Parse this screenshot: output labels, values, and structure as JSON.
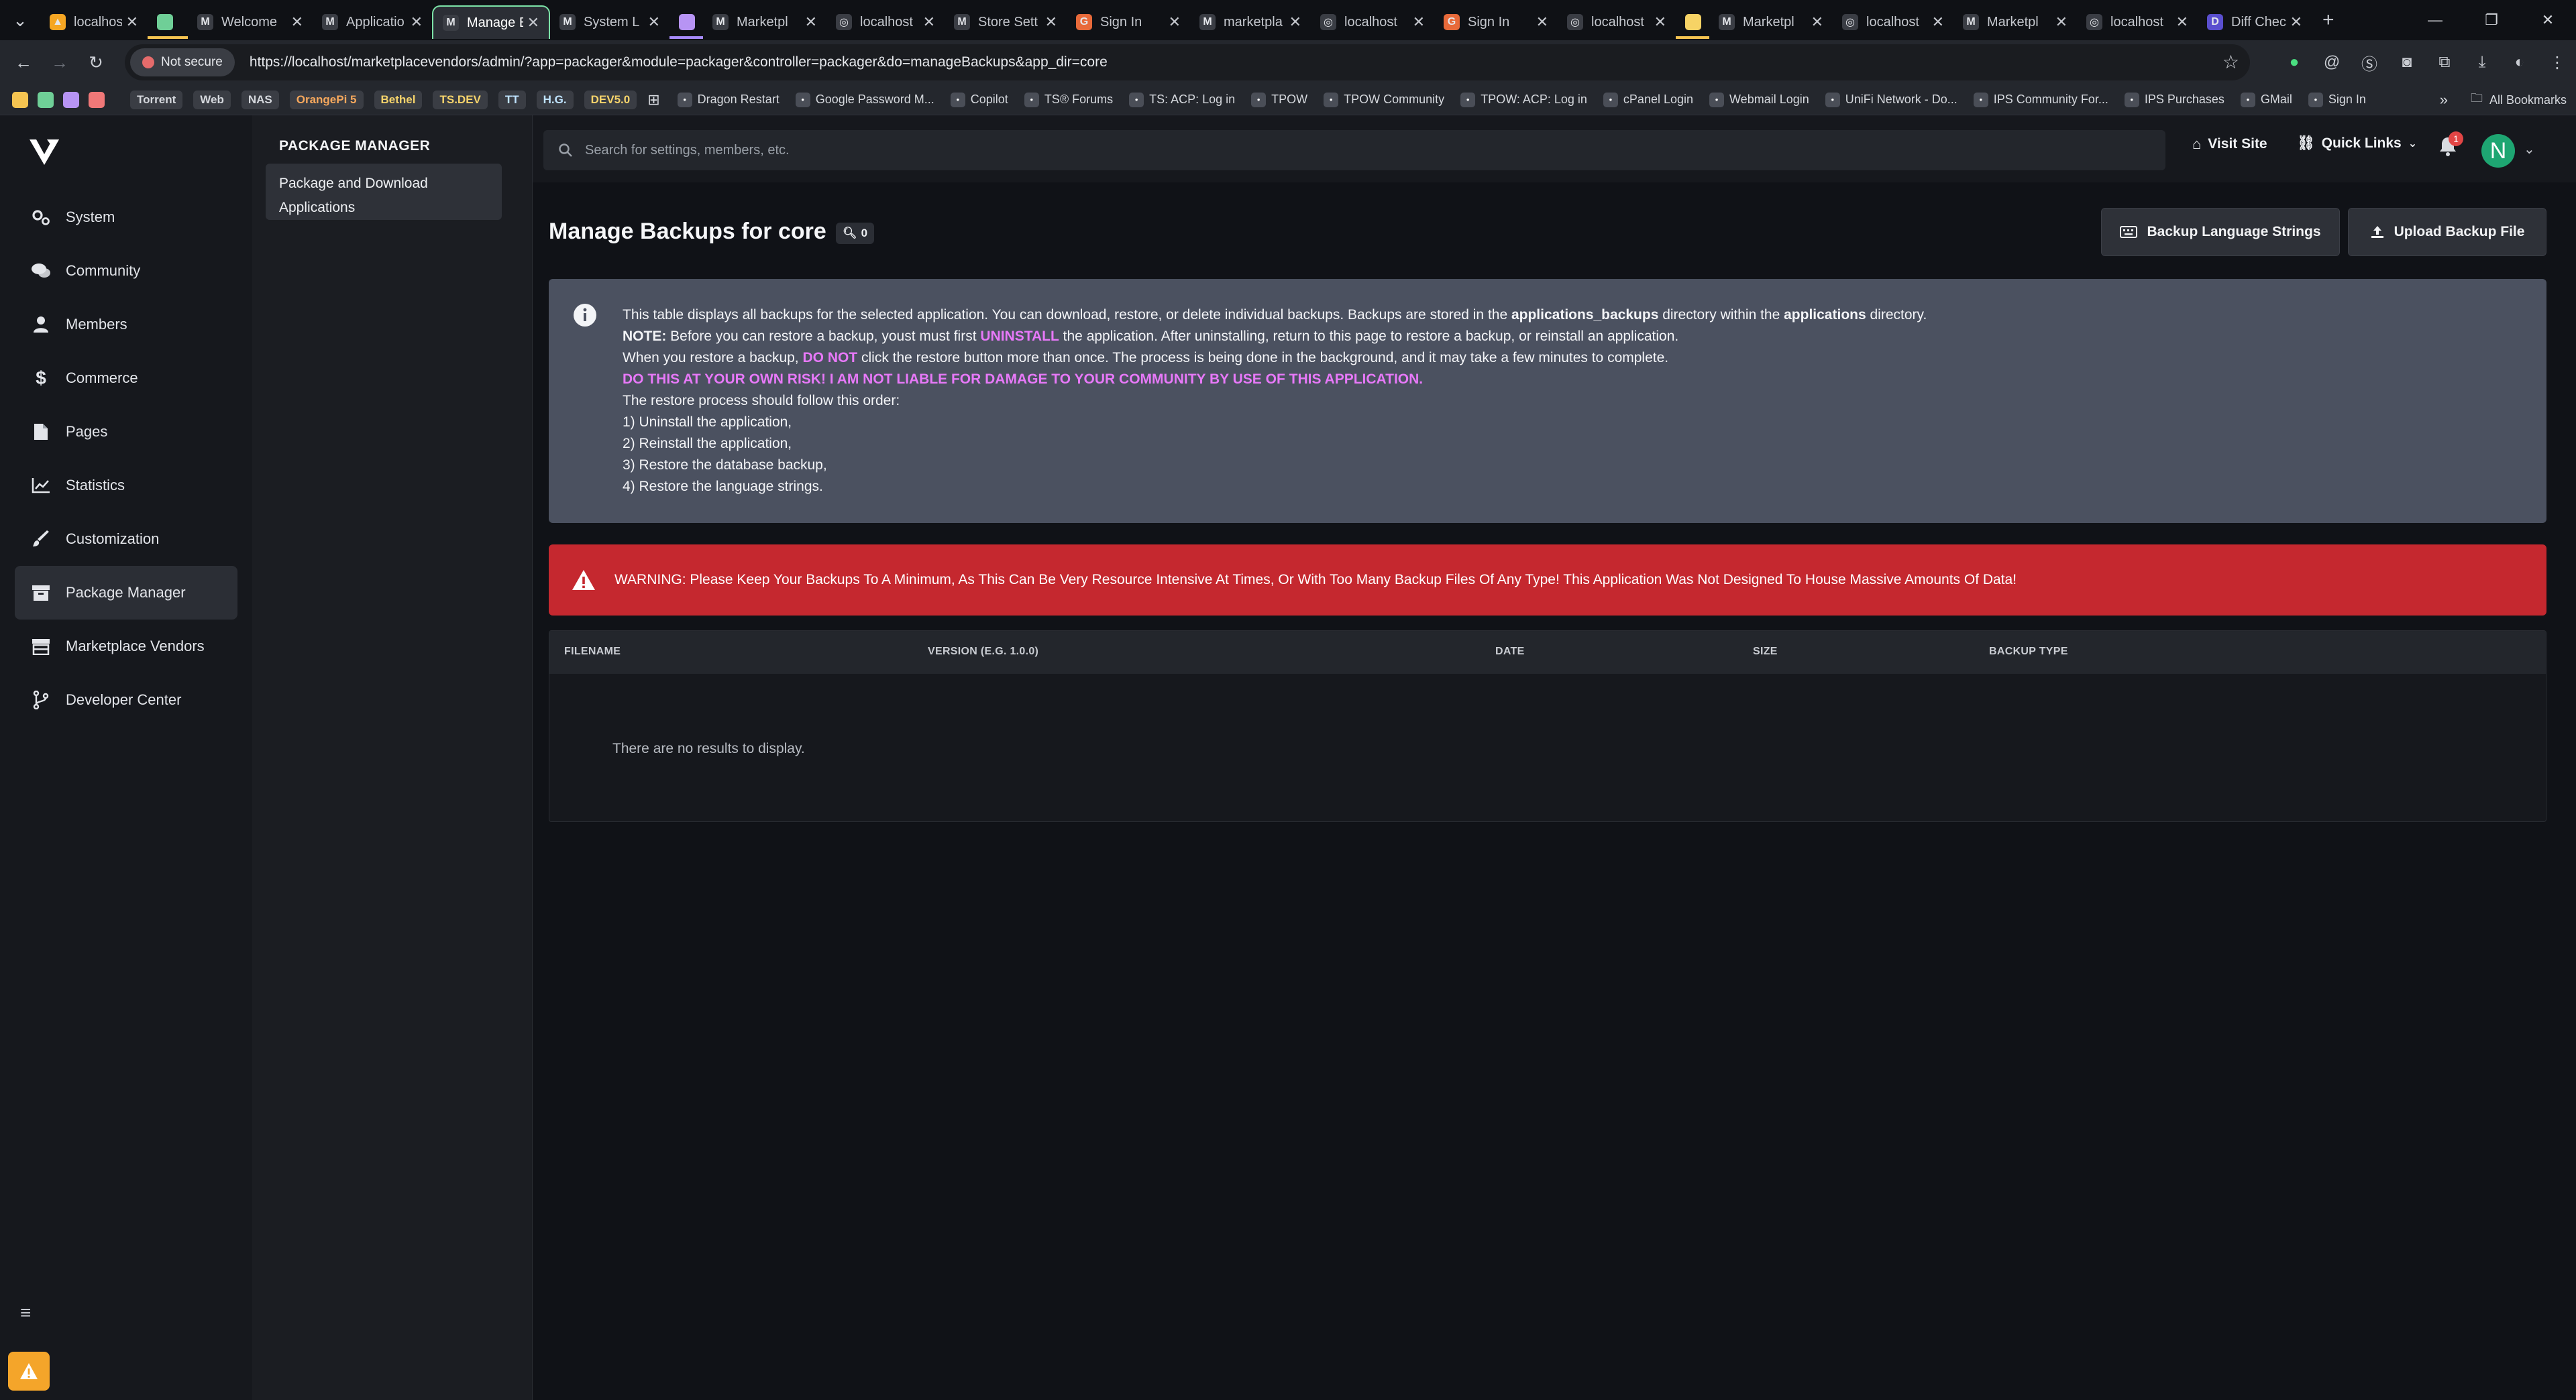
{
  "browser": {
    "tabs": [
      {
        "title": "localhost",
        "fav": "▲",
        "color": "#f5a623"
      },
      {
        "title": "",
        "fav": "",
        "color": "#6fcf97"
      },
      {
        "title": "Welcome",
        "fav": "M",
        "color": "#3a3d44"
      },
      {
        "title": "Applicatio",
        "fav": "M",
        "color": "#3a3d44"
      },
      {
        "title": "Manage B",
        "fav": "M",
        "color": "#3a3d44"
      },
      {
        "title": "System L",
        "fav": "M",
        "color": "#3a3d44"
      },
      {
        "title": "",
        "fav": "",
        "color": "#b794f4"
      },
      {
        "title": "Marketpl",
        "fav": "M",
        "color": "#3a3d44"
      },
      {
        "title": "localhost",
        "fav": "◎",
        "color": "#3a3d44"
      },
      {
        "title": "Store Sett",
        "fav": "M",
        "color": "#3a3d44"
      },
      {
        "title": "Sign In",
        "fav": "G",
        "color": "#e86a3a"
      },
      {
        "title": "marketpla",
        "fav": "M",
        "color": "#3a3d44"
      },
      {
        "title": "localhost",
        "fav": "◎",
        "color": "#3a3d44"
      },
      {
        "title": "Sign In",
        "fav": "G",
        "color": "#e86a3a"
      },
      {
        "title": "localhost",
        "fav": "◎",
        "color": "#3a3d44"
      },
      {
        "title": "",
        "fav": "",
        "color": "#f6d365"
      },
      {
        "title": "Marketpl",
        "fav": "M",
        "color": "#3a3d44"
      },
      {
        "title": "localhost",
        "fav": "◎",
        "color": "#3a3d44"
      },
      {
        "title": "Marketpl",
        "fav": "M",
        "color": "#3a3d44"
      },
      {
        "title": "localhost",
        "fav": "◎",
        "color": "#3a3d44"
      },
      {
        "title": "Diff Chec",
        "fav": "D",
        "color": "#5a4fcf"
      }
    ],
    "not_secure": "Not secure",
    "url": "https://localhost/marketplacevendors/admin/?app=packager&module=packager&controller=packager&do=manageBackups&app_dir=core",
    "bookmarks": [
      "Torrent",
      "Web",
      "NAS",
      "OrangePi 5",
      "Bethel",
      "TS.DEV",
      "TT",
      "H.G.",
      "DEV5.0",
      "Dragon Restart",
      "Google Password M...",
      "Copilot",
      "TS® Forums",
      "TS: ACP: Log in",
      "TPOW",
      "TPOW Community",
      "TPOW: ACP: Log in",
      "cPanel Login",
      "Webmail Login",
      "UniFi Network - Do...",
      "IPS Community For...",
      "IPS Purchases",
      "GMail",
      "Sign In"
    ],
    "all_bookmarks": "All Bookmarks"
  },
  "sidebar": {
    "items": [
      {
        "label": "System",
        "icon": "cogs-icon"
      },
      {
        "label": "Community",
        "icon": "comments-icon"
      },
      {
        "label": "Members",
        "icon": "user-icon"
      },
      {
        "label": "Commerce",
        "icon": "dollar-icon"
      },
      {
        "label": "Pages",
        "icon": "page-icon"
      },
      {
        "label": "Statistics",
        "icon": "chart-icon"
      },
      {
        "label": "Customization",
        "icon": "brush-icon"
      },
      {
        "label": "Package Manager",
        "icon": "box-icon"
      },
      {
        "label": "Marketplace Vendors",
        "icon": "store-icon"
      },
      {
        "label": "Developer Center",
        "icon": "branch-icon"
      }
    ],
    "active_index": 7
  },
  "subnav": {
    "heading": "PACKAGE MANAGER",
    "item_line1": "Package and Download",
    "item_line2": "Applications"
  },
  "header": {
    "search_placeholder": "Search for settings, members, etc.",
    "visit_site": "Visit Site",
    "quick_links": "Quick Links",
    "notifications": "1",
    "avatar_initial": "N"
  },
  "main": {
    "title": "Manage Backups for core",
    "count": "0",
    "btn_lang": "Backup Language Strings",
    "btn_upload": "Upload Backup File",
    "info": {
      "l1a": "This table displays all backups for the selected application. You can download, restore, or delete individual backups. Backups are stored in the ",
      "l1b": "applications_backups",
      "l1c": " directory within the ",
      "l1d": "applications",
      "l1e": " directory.",
      "l2a": "NOTE:",
      "l2b": " Before you can restore a backup, youst must first ",
      "l2c": "UNINSTALL",
      "l2d": " the application. After uninstalling, return to this page to restore a backup, or reinstall an application.",
      "l3a": "When you restore a backup, ",
      "l3b": "DO NOT",
      "l3c": " click the restore button more than once. The process is being done in the background, and it may take a few minutes to complete.",
      "l4": "DO THIS AT YOUR OWN RISK! I AM NOT LIABLE FOR DAMAGE TO YOUR COMMUNITY BY USE OF THIS APPLICATION.",
      "l5": "The restore process should follow this order:",
      "steps": [
        "1) Uninstall the application,",
        "2) Reinstall the application,",
        "3) Restore the database backup,",
        "4) Restore the language strings."
      ]
    },
    "warning": "WARNING: Please Keep Your Backups To A Minimum, As This Can Be Very Resource Intensive At Times, Or With Too Many Backup Files Of Any Type! This Application Was Not Designed To House Massive Amounts Of Data!",
    "table": {
      "columns": [
        "FILENAME",
        "VERSION (E.G. 1.0.0)",
        "DATE",
        "SIZE",
        "BACKUP TYPE"
      ],
      "empty": "There are no results to display."
    }
  },
  "colors": {
    "info_bg": "#4b5160",
    "danger_bg": "#c5282f",
    "accent_pink": "#e879f9",
    "active_tab_border": "#7ce3a7",
    "avatar": "#1ea672"
  }
}
